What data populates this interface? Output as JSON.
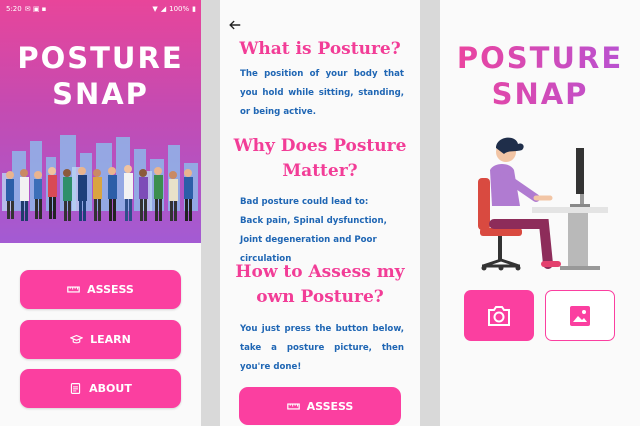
{
  "screen1": {
    "status": {
      "time": "5:20",
      "battery": "100%"
    },
    "title_line1": "POSTURE",
    "title_line2": "SNAP",
    "buttons": [
      {
        "label": "ASSESS",
        "icon": "ruler-icon"
      },
      {
        "label": "LEARN",
        "icon": "graduation-cap-icon"
      },
      {
        "label": "ABOUT",
        "icon": "document-icon"
      }
    ]
  },
  "screen2": {
    "back_icon": "arrow-left-icon",
    "heading1": "What is Posture?",
    "para1": "The position of your body that you hold while sitting, standing, or being active.",
    "heading2_line1": "Why Does Posture",
    "heading2_line2": "Matter?",
    "para2_line1": "Bad posture could lead to:",
    "para2_line2": "Back pain, Spinal dysfunction, Joint degeneration and Poor circulation",
    "heading3_line1": "How to Assess my",
    "heading3_line2": "own Posture?",
    "para3": "You just press the button below, take a posture picture, then you're done!",
    "assess_label": "ASSESS"
  },
  "screen3": {
    "title_line1": "POSTURE",
    "title_line2": "SNAP",
    "camera_icon": "camera-icon",
    "gallery_icon": "image-icon"
  },
  "colors": {
    "accent": "#fb3fa0",
    "heading": "#f23d97",
    "body_text": "#1f66b4",
    "gradient_top": "#e8459a",
    "gradient_bottom": "#a35bd3"
  }
}
